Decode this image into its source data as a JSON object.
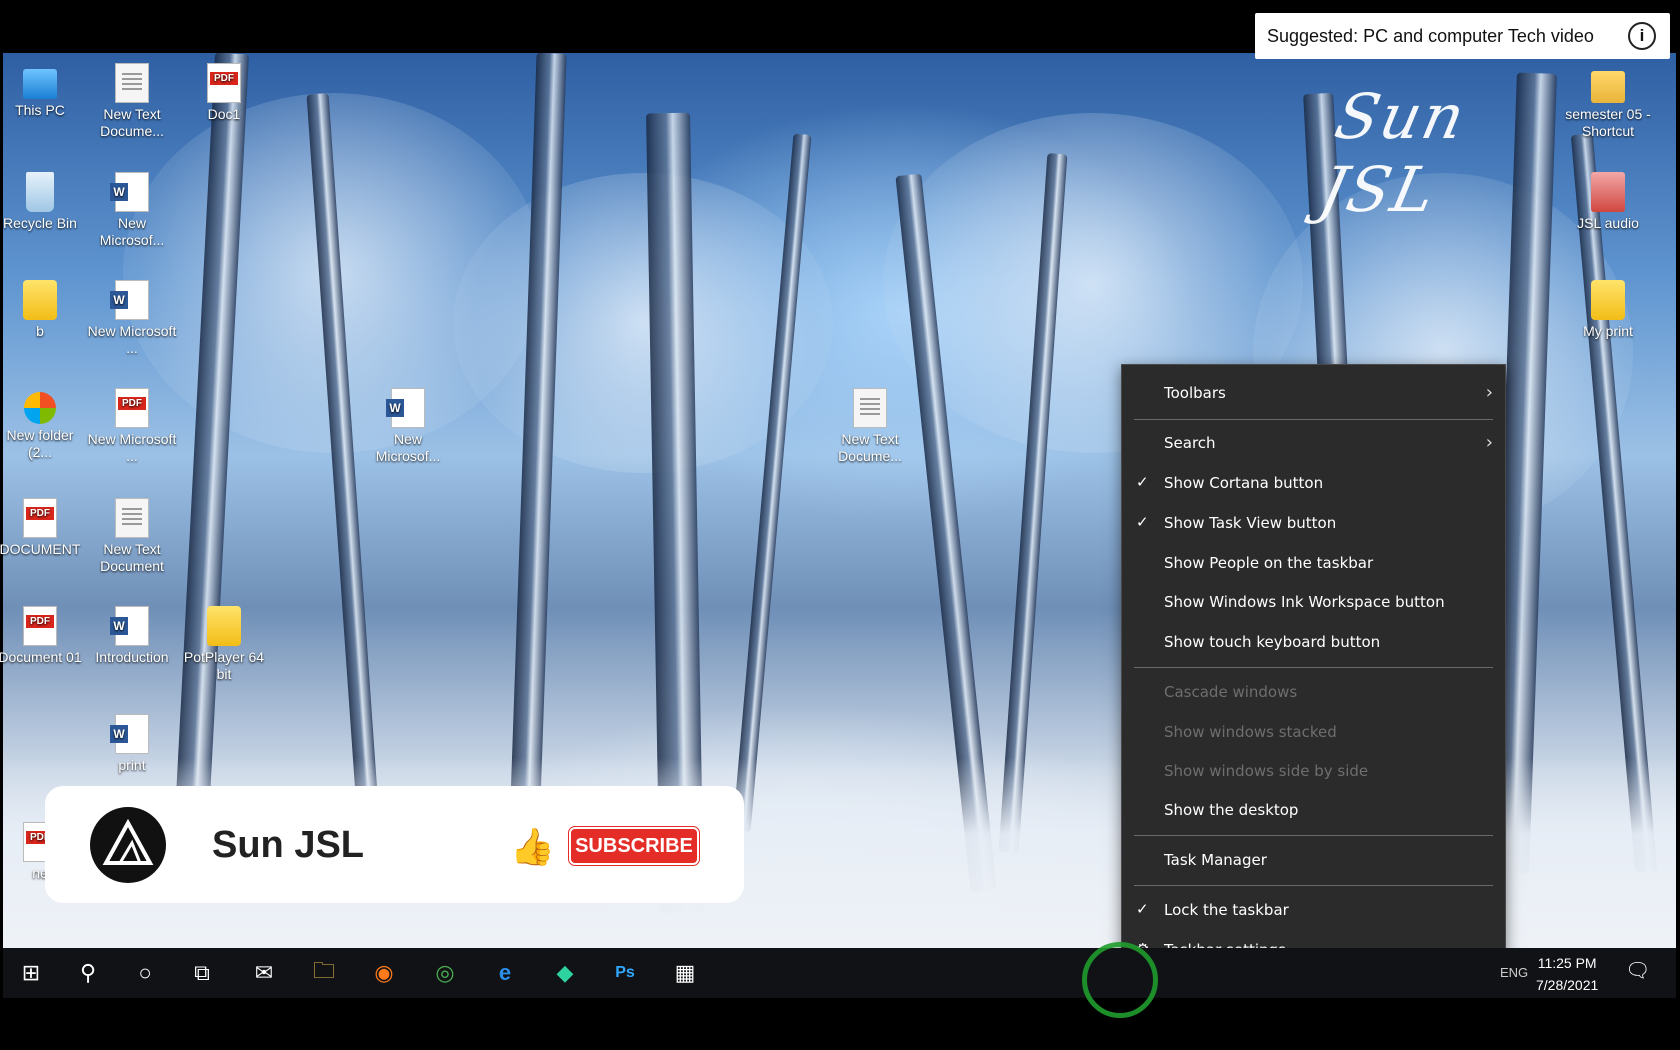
{
  "suggestion": {
    "text": "Suggested: PC and computer Tech video",
    "info_icon": "info-icon",
    "info_glyph": "i"
  },
  "watermark": {
    "text": "Sun JSL"
  },
  "desktop_icons": [
    {
      "label": "This PC",
      "icon": "this-pc-icon"
    },
    {
      "label": "New Text Docume...",
      "icon": "text-document-icon"
    },
    {
      "label": "Doc1",
      "icon": "pdf-icon"
    },
    {
      "label": "Recycle Bin",
      "icon": "recycle-bin-icon"
    },
    {
      "label": "New Microsof...",
      "icon": "word-document-icon"
    },
    {
      "label": "b",
      "icon": "folder-icon"
    },
    {
      "label": "New Microsoft ...",
      "icon": "word-document-icon"
    },
    {
      "label": "New folder (2...",
      "icon": "edge-legacy-icon"
    },
    {
      "label": "New Microsoft ...",
      "icon": "pdf-icon"
    },
    {
      "label": "New Microsof...",
      "icon": "word-document-icon"
    },
    {
      "label": "New Text Docume...",
      "icon": "text-document-icon"
    },
    {
      "label": "DOCUMENT",
      "icon": "pdf-icon"
    },
    {
      "label": "New Text Document",
      "icon": "text-document-icon"
    },
    {
      "label": "Document 01",
      "icon": "pdf-icon"
    },
    {
      "label": "Introduction",
      "icon": "word-document-icon"
    },
    {
      "label": "PotPlayer 64 bit",
      "icon": "potplayer-icon"
    },
    {
      "label": "print",
      "icon": "word-document-icon"
    },
    {
      "label": "ne",
      "icon": "pdf-icon"
    },
    {
      "label": "semester 05 - Shortcut",
      "icon": "folder-shortcut-icon"
    },
    {
      "label": "JSL audio",
      "icon": "audio-folder-icon"
    },
    {
      "label": "My print",
      "icon": "folder-icon"
    }
  ],
  "pdf_badge": "PDF",
  "word_badge": "W",
  "context_menu": {
    "items": [
      {
        "label": "Toolbars",
        "submenu": true,
        "checked": false,
        "disabled": false
      },
      {
        "label": "Search",
        "submenu": true,
        "checked": false,
        "disabled": false
      },
      {
        "label": "Show Cortana button",
        "submenu": false,
        "checked": true,
        "disabled": false
      },
      {
        "label": "Show Task View button",
        "submenu": false,
        "checked": true,
        "disabled": false
      },
      {
        "label": "Show People on the taskbar",
        "submenu": false,
        "checked": false,
        "disabled": false
      },
      {
        "label": "Show Windows Ink Workspace button",
        "submenu": false,
        "checked": false,
        "disabled": false
      },
      {
        "label": "Show touch keyboard button",
        "submenu": false,
        "checked": false,
        "disabled": false
      },
      {
        "label": "Cascade windows",
        "submenu": false,
        "checked": false,
        "disabled": true
      },
      {
        "label": "Show windows stacked",
        "submenu": false,
        "checked": false,
        "disabled": true
      },
      {
        "label": "Show windows side by side",
        "submenu": false,
        "checked": false,
        "disabled": true
      },
      {
        "label": "Show the desktop",
        "submenu": false,
        "checked": false,
        "disabled": false
      },
      {
        "label": "Task Manager",
        "submenu": false,
        "checked": false,
        "disabled": false
      },
      {
        "label": "Lock the taskbar",
        "submenu": false,
        "checked": true,
        "disabled": false
      },
      {
        "label": "Taskbar settings",
        "submenu": false,
        "checked": false,
        "disabled": false,
        "icon": "gear-icon"
      }
    ],
    "check_glyph": "✓",
    "arrow_glyph": "›",
    "gear_glyph": "⚙"
  },
  "subscribe_overlay": {
    "channel": "Sun JSL",
    "button": "SUBSCRIBE",
    "thumb_glyph": "👍"
  },
  "taskbar": {
    "buttons": [
      {
        "name": "start-button",
        "icon": "windows-logo-icon",
        "glyph": "⊞"
      },
      {
        "name": "search-button",
        "icon": "search-icon",
        "glyph": "⚲"
      },
      {
        "name": "cortana-button",
        "icon": "cortana-circle-icon",
        "glyph": "○"
      },
      {
        "name": "task-view-button",
        "icon": "task-view-icon",
        "glyph": "⧉"
      },
      {
        "name": "mail-button",
        "icon": "mail-icon",
        "glyph": "✉"
      },
      {
        "name": "file-explorer-button",
        "icon": "folder-icon",
        "glyph": "🗀"
      },
      {
        "name": "firefox-button",
        "icon": "firefox-icon",
        "glyph": "◉"
      },
      {
        "name": "chrome-button",
        "icon": "chrome-icon",
        "glyph": "◎"
      },
      {
        "name": "edge-button",
        "icon": "edge-icon",
        "glyph": "e"
      },
      {
        "name": "filmora-button",
        "icon": "filmora-icon",
        "glyph": "◆"
      },
      {
        "name": "photoshop-button",
        "icon": "photoshop-icon",
        "glyph": "Ps"
      },
      {
        "name": "app-button",
        "icon": "app-icon",
        "glyph": "▦"
      }
    ],
    "language": "ENG",
    "time": "11:25 PM",
    "date": "7/28/2021",
    "notification_glyph": "🗨"
  },
  "colors": {
    "accent_red": "#e52d27",
    "menu_bg": "#2b2b2b",
    "cursor_ring": "#1f9c2c"
  }
}
